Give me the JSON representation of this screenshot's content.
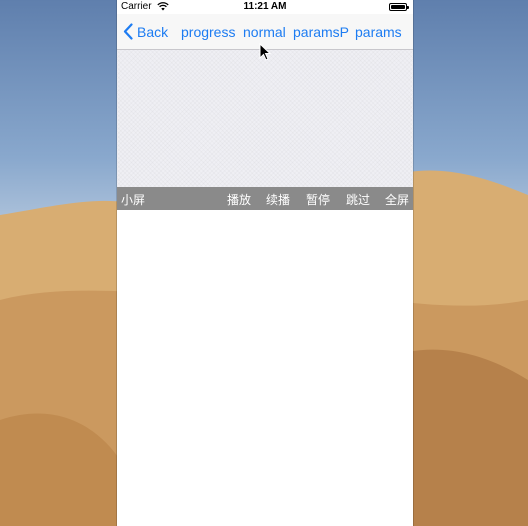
{
  "status_bar": {
    "carrier": "Carrier",
    "time": "11:21 AM"
  },
  "nav_bar": {
    "back_label": "Back",
    "items": [
      "progress",
      "normal",
      "paramsP",
      "params"
    ],
    "tint_color": "#1d7cf2"
  },
  "player_controls": {
    "small_screen": "小屏",
    "play": "播放",
    "resume": "续播",
    "pause": "暂停",
    "skip": "跳过",
    "full_screen": "全屏"
  },
  "icons": {
    "wifi": "wifi-icon",
    "battery": "battery-icon",
    "back": "chevron-left-icon",
    "cursor": "mouse-pointer-icon"
  }
}
